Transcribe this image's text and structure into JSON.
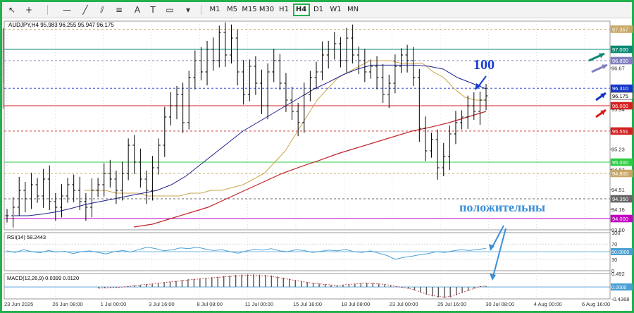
{
  "window": {
    "symbol_header": "AUDJPY,H4  95.983 96.255 95.947 96.175"
  },
  "toolbar": {
    "icons": [
      "cursor-icon",
      "crosshair-icon",
      "horizontal-line-icon",
      "trendline-icon",
      "equidistant-channel-icon",
      "fibonacci-icon",
      "text-icon",
      "text-label-icon",
      "rectangle-icon",
      "shapes-icon"
    ],
    "timeframes": [
      "M1",
      "M5",
      "M15",
      "M30",
      "H1",
      "H4",
      "D1",
      "W1",
      "MN"
    ],
    "active_timeframe": "H4"
  },
  "colors": {
    "price_line": "#000000",
    "ma_fast": "#c9a54a",
    "ma_mid": "#1f1f8f",
    "ma_slow": "#c0262d",
    "level_green": "#0d8a74",
    "level_red": "#d42020",
    "level_blue": "#1435c8",
    "level_purple": "#8080c0",
    "level_magenta": "#c000c0",
    "level_lime": "#2ecc40",
    "level_tan": "#c8a866",
    "annotation_blue": "#1a3fd0",
    "rsi_line": "#4a9fd4",
    "macd_hist": "#555555",
    "macd_signal": "#c0262d"
  },
  "annotations": {
    "label_100": "100",
    "label_positive": "положительны"
  },
  "chart_data": [
    {
      "type": "line",
      "title": "AUDJPY,H4",
      "ohlc_header": {
        "open": 95.983,
        "high": 96.255,
        "low": 95.947,
        "close": 96.175
      },
      "x_tick_labels": [
        "23 Jun 2025",
        "26 Jun 08:00",
        "1 Jul 00:00",
        "3 Jul 16:00",
        "8 Jul 08:00",
        "11 Jul 00:00",
        "15 Jul 16:00",
        "18 Jul 08:00",
        "23 Jul 00:00",
        "25 Jul 16:00",
        "30 Jul 08:00",
        "4 Aug 00:00",
        "6 Aug 16:00"
      ],
      "y_tick_labels": [
        93.8,
        94.16,
        94.51,
        94.87,
        95.23,
        95.58,
        95.94,
        96.67
      ],
      "ylim": [
        93.8,
        97.5
      ],
      "price_levels": [
        {
          "value": 97.357,
          "label": "97.357",
          "color": "#c8a866",
          "style": "dashed"
        },
        {
          "value": 97.0,
          "label": "97.000",
          "color": "#0d8a74",
          "style": "solid"
        },
        {
          "value": 96.8,
          "label": "96.800",
          "color": "#8080c0",
          "style": "dashed"
        },
        {
          "value": 96.31,
          "label": "96.310",
          "color": "#1435c8",
          "style": "dashed"
        },
        {
          "value": 96.175,
          "label": "96.175",
          "color": "#000000",
          "style": "current"
        },
        {
          "value": 96.0,
          "label": "96.000",
          "color": "#d42020",
          "style": "solid"
        },
        {
          "value": 95.551,
          "label": "95.551",
          "color": "#d42020",
          "style": "dashed"
        },
        {
          "value": 95.0,
          "label": "95.000",
          "color": "#2ecc40",
          "style": "solid"
        },
        {
          "value": 94.8,
          "label": "94.800",
          "color": "#c8a866",
          "style": "dashed"
        },
        {
          "value": 94.35,
          "label": "94.350",
          "color": "#666666",
          "style": "dashed"
        },
        {
          "value": 94.0,
          "label": "94.000",
          "color": "#c000c0",
          "style": "solid"
        }
      ],
      "series": [
        {
          "name": "AUDJPY price",
          "y": [
            94.05,
            94.2,
            94.5,
            94.35,
            94.6,
            94.4,
            94.7,
            94.3,
            94.2,
            94.4,
            94.6,
            94.5,
            94.3,
            94.2,
            94.5,
            94.6,
            94.8,
            94.7,
            94.5,
            94.8,
            95.3,
            95.0,
            94.7,
            94.5,
            94.9,
            95.3,
            95.8,
            96.0,
            96.2,
            95.7,
            96.5,
            96.8,
            96.6,
            97.0,
            96.8,
            97.3,
            96.9,
            97.2,
            96.6,
            96.2,
            96.7,
            96.4,
            96.0,
            96.6,
            96.8,
            96.4,
            96.1,
            95.9,
            95.7,
            96.2,
            96.5,
            96.6,
            96.9,
            97.0,
            97.1,
            96.8,
            97.2,
            96.9,
            96.8,
            96.6,
            96.7,
            96.5,
            96.2,
            96.4,
            96.7,
            96.9,
            96.8,
            96.5,
            95.6,
            95.2,
            95.4,
            94.9,
            95.1,
            95.5,
            95.7,
            95.8,
            96.0,
            95.9,
            96.1,
            96.175
          ]
        },
        {
          "name": "MA fast",
          "y": [
            94.5,
            94.5,
            94.5,
            94.45,
            94.45,
            94.45,
            94.4,
            94.4,
            94.4,
            94.4,
            94.45,
            94.45,
            94.5,
            94.5,
            94.55,
            94.6,
            94.7,
            94.8,
            95.0,
            95.2,
            95.5,
            95.8,
            96.1,
            96.3,
            96.5,
            96.6,
            96.7,
            96.8,
            96.8,
            96.8,
            96.75,
            96.75,
            96.75,
            96.6,
            96.5,
            96.3,
            96.15,
            96.1,
            96.1
          ]
        },
        {
          "name": "MA mid",
          "y": [
            94.05,
            94.05,
            94.08,
            94.12,
            94.18,
            94.25,
            94.3,
            94.35,
            94.4,
            94.45,
            94.5,
            94.6,
            94.75,
            94.95,
            95.15,
            95.35,
            95.55,
            95.7,
            95.85,
            96.0,
            96.15,
            96.3,
            96.42,
            96.55,
            96.65,
            96.72,
            96.72,
            96.72,
            96.72,
            96.7,
            96.65,
            96.5,
            96.4,
            96.3
          ]
        },
        {
          "name": "MA slow",
          "y": [
            93.85,
            93.9,
            94.0,
            94.1,
            94.2,
            94.35,
            94.5,
            94.65,
            94.8,
            94.92,
            95.03,
            95.15,
            95.25,
            95.35,
            95.45,
            95.55,
            95.62,
            95.7,
            95.8,
            95.9
          ]
        }
      ]
    },
    {
      "type": "line",
      "title": "RSI(14) 58.2443",
      "y_tick_labels": [
        100,
        70,
        30,
        0
      ],
      "current_label": "50.0000",
      "ylim": [
        0,
        100
      ],
      "series": [
        {
          "name": "RSI",
          "y": [
            52,
            48,
            55,
            50,
            47,
            53,
            49,
            51,
            45,
            50,
            52,
            48,
            44,
            50,
            53,
            49,
            56,
            62,
            58,
            52,
            55,
            60,
            58,
            62,
            57,
            53,
            55,
            50,
            46,
            52,
            56,
            54,
            58,
            52,
            50,
            55,
            53,
            48,
            51,
            54,
            52,
            56,
            50,
            48,
            52,
            46,
            40,
            30,
            35,
            38,
            42,
            45,
            50,
            48,
            52,
            55,
            53,
            56,
            58.2443
          ]
        }
      ]
    },
    {
      "type": "bar",
      "title": "MACD(12,26,9) 0.0399 0.0120",
      "y_tick_labels": [
        0.492,
        0.0,
        -0.4368
      ],
      "current_label": "0.0000",
      "ylim": [
        -0.4368,
        0.492
      ],
      "series": [
        {
          "name": "MACD",
          "values": [
            -0.05,
            -0.04,
            -0.03,
            -0.02,
            0.0,
            0.02,
            0.05,
            0.08,
            0.1,
            0.12,
            0.15,
            0.18,
            0.2,
            0.22,
            0.25,
            0.28,
            0.3,
            0.32,
            0.34,
            0.36,
            0.38,
            0.4,
            0.42,
            0.44,
            0.45,
            0.46,
            0.46,
            0.45,
            0.44,
            0.42,
            0.38,
            0.34,
            0.3,
            0.26,
            0.22,
            0.18,
            0.15,
            0.12,
            0.1,
            0.08,
            0.06,
            0.08,
            0.1,
            0.12,
            0.14,
            0.15,
            0.14,
            0.12,
            0.1,
            0.06,
            0.02,
            -0.02,
            -0.06,
            -0.12,
            -0.2,
            -0.28,
            -0.34,
            -0.38,
            -0.4,
            -0.38,
            -0.3,
            -0.22,
            -0.14,
            -0.06,
            0.02,
            0.04
          ]
        }
      ]
    }
  ]
}
